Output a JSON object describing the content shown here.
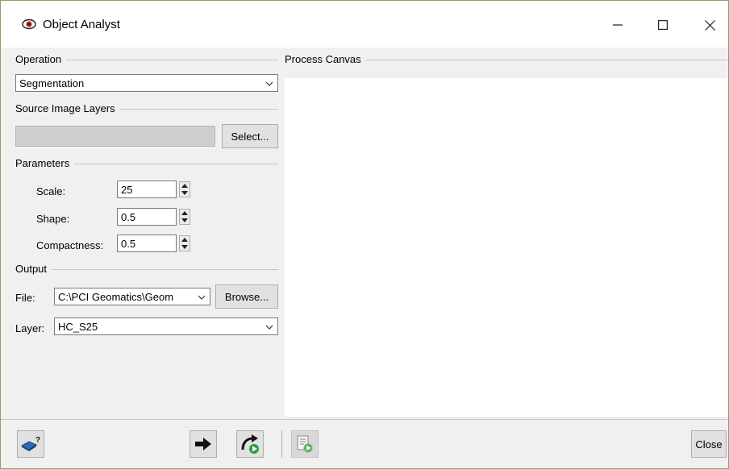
{
  "window": {
    "title": "Object Analyst",
    "minimize_label": "Minimize",
    "maximize_label": "Maximize",
    "close_label": "Close"
  },
  "operation": {
    "group_label": "Operation",
    "selected": "Segmentation"
  },
  "source": {
    "group_label": "Source Image Layers",
    "layer_value": "",
    "select_button": "Select..."
  },
  "parameters": {
    "group_label": "Parameters",
    "scale_label": "Scale:",
    "scale_value": "25",
    "shape_label": "Shape:",
    "shape_value": "0.5",
    "compactness_label": "Compactness:",
    "compactness_value": "0.5"
  },
  "output": {
    "group_label": "Output",
    "file_label": "File:",
    "file_value": "C:\\PCI Geomatics\\Geom",
    "browse_button": "Browse...",
    "layer_label": "Layer:",
    "layer_value": "HC_S25"
  },
  "canvas": {
    "group_label": "Process Canvas"
  },
  "toolbar": {
    "help_icon": "help-book-icon",
    "run_icon": "arrow-right-icon",
    "run_next_icon": "redo-run-icon",
    "batch_icon": "batch-run-icon",
    "close_button": "Close"
  }
}
